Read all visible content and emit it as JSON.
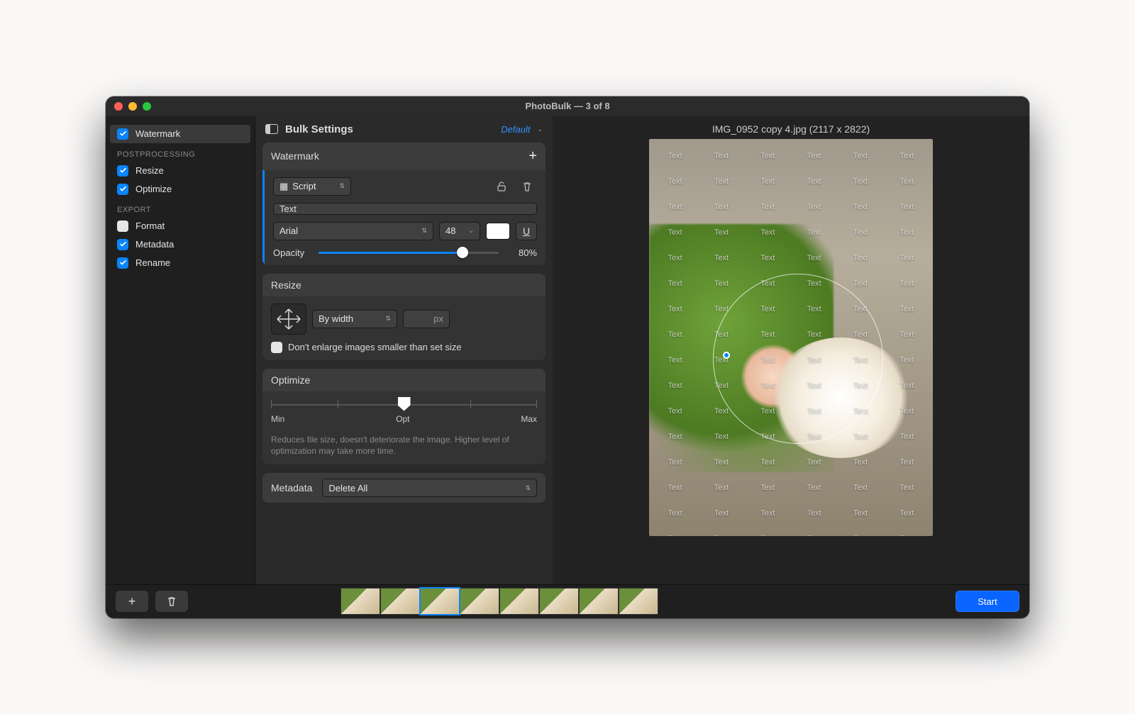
{
  "title": "PhotoBulk — 3 of 8",
  "sidebar": {
    "watermark": "Watermark",
    "group_post": "POSTPROCESSING",
    "resize": "Resize",
    "optimize": "Optimize",
    "group_export": "EXPORT",
    "format": "Format",
    "metadata": "Metadata",
    "rename": "Rename"
  },
  "settings": {
    "title": "Bulk Settings",
    "preset": "Default",
    "watermark": {
      "title": "Watermark",
      "type": "Script",
      "text_label": "Text",
      "font": "Arial",
      "size": "48",
      "underline": "U",
      "opacity_label": "Opacity",
      "opacity": "80%"
    },
    "resize": {
      "title": "Resize",
      "mode": "By width",
      "unit": "px",
      "no_enlarge": "Don't enlarge images smaller than set size"
    },
    "optimize": {
      "title": "Optimize",
      "min": "Min",
      "opt": "Opt",
      "max": "Max",
      "hint": "Reduces file size, doesn't deteriorate the image. Higher level of optimization may take more time."
    },
    "metadata": {
      "title": "Metadata",
      "mode": "Delete All"
    }
  },
  "preview": {
    "title": "IMG_0952 copy 4.jpg (2117 x 2822)",
    "wm_text": "Text"
  },
  "bottom": {
    "start": "Start"
  }
}
